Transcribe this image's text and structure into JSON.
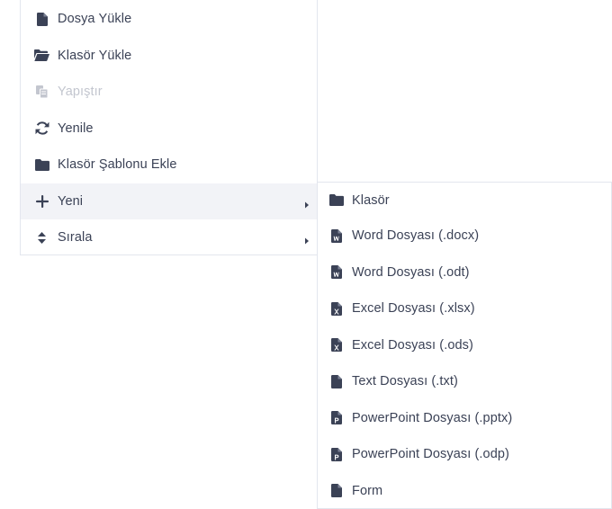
{
  "main_menu": {
    "items": [
      {
        "label": "Dosya Yükle",
        "icon": "file-icon"
      },
      {
        "label": "Klasör Yükle",
        "icon": "folder-open-icon"
      },
      {
        "label": "Yapıştır",
        "icon": "paste-icon",
        "disabled": true
      },
      {
        "label": "Yenile",
        "icon": "refresh-icon"
      },
      {
        "label": "Klasör Şablonu Ekle",
        "icon": "folder-icon"
      },
      {
        "label": "Yeni",
        "icon": "plus-icon",
        "submenu": true,
        "active": true
      },
      {
        "label": "Sırala",
        "icon": "sort-icon",
        "submenu": true
      }
    ]
  },
  "sub_menu": {
    "items": [
      {
        "label": "Klasör",
        "icon": "folder-icon"
      },
      {
        "label": "Word Dosyası (.docx)",
        "icon": "word-file-icon"
      },
      {
        "label": "Word Dosyası (.odt)",
        "icon": "word-file-icon"
      },
      {
        "label": "Excel Dosyası (.xlsx)",
        "icon": "excel-file-icon"
      },
      {
        "label": "Excel Dosyası (.ods)",
        "icon": "excel-file-icon"
      },
      {
        "label": "Text Dosyası (.txt)",
        "icon": "file-icon"
      },
      {
        "label": "PowerPoint Dosyası (.pptx)",
        "icon": "powerpoint-file-icon"
      },
      {
        "label": "PowerPoint Dosyası (.odp)",
        "icon": "powerpoint-file-icon"
      },
      {
        "label": "Form",
        "icon": "file-icon"
      }
    ]
  },
  "colors": {
    "icon": "#3b4256",
    "text": "#3b4256",
    "disabled": "#c3c6cf",
    "active_bg": "#f2f3f7",
    "border": "#e3e6ee"
  }
}
